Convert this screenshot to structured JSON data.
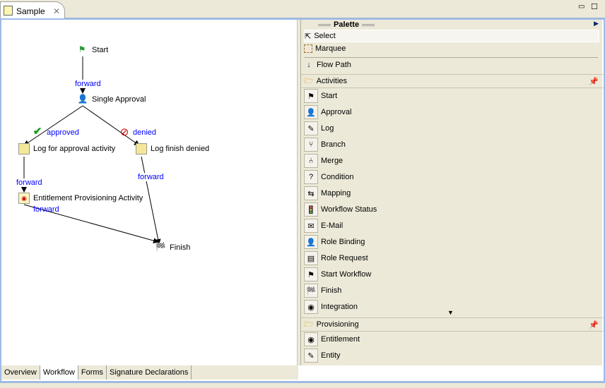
{
  "editor": {
    "tab_title": "Sample"
  },
  "diagram": {
    "nodes": {
      "start": "Start",
      "single_approval": "Single Approval",
      "log_approval": "Log for approval activity",
      "log_denied": "Log finish denied",
      "entitlement": "Entitlement Provisioning Activity",
      "finish": "Finish"
    },
    "edges": {
      "start_forward": "forward",
      "approved": "approved",
      "denied": "denied",
      "log_forward": "forward",
      "denied_forward": "forward",
      "ent_forward": "forward"
    }
  },
  "palette": {
    "title": "Palette",
    "tools": [
      "Select",
      "Marquee",
      "Flow Path"
    ],
    "activities_label": "Activities",
    "activities": [
      "Start",
      "Approval",
      "Log",
      "Branch",
      "Merge",
      "Condition",
      "Mapping",
      "Workflow Status",
      "E-Mail",
      "Role Binding",
      "Role Request",
      "Start Workflow",
      "Finish",
      "Integration"
    ],
    "provisioning_label": "Provisioning",
    "provisioning": [
      "Entitlement",
      "Entity"
    ]
  },
  "bottom_tabs": [
    "Overview",
    "Workflow",
    "Forms",
    "Signature Declarations"
  ]
}
